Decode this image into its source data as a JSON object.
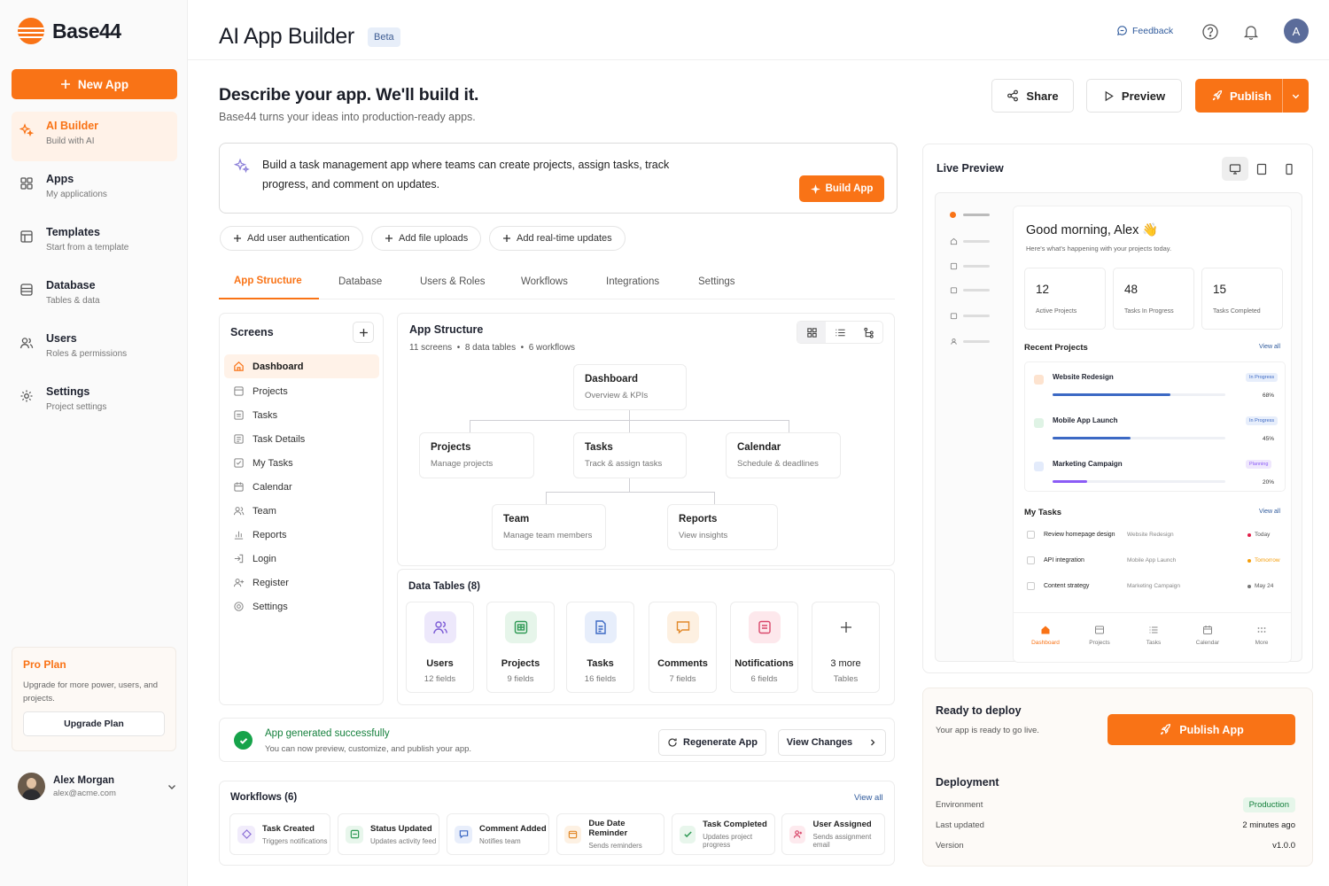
{
  "sidebar": {
    "brand": "Base44",
    "new_app": "New App",
    "items": [
      {
        "title": "AI Builder",
        "sub": "Build with AI",
        "icon": "sparkles-icon"
      },
      {
        "title": "Apps",
        "sub": "My applications",
        "icon": "grid-icon"
      },
      {
        "title": "Templates",
        "sub": "Start from a template",
        "icon": "template-icon"
      },
      {
        "title": "Database",
        "sub": "Tables & data",
        "icon": "database-icon"
      },
      {
        "title": "Users",
        "sub": "Roles & permissions",
        "icon": "users-icon"
      },
      {
        "title": "Settings",
        "sub": "Project settings",
        "icon": "gear-icon"
      }
    ],
    "pro": {
      "title": "Pro Plan",
      "desc": "Upgrade for more power, users, and projects.",
      "button": "Upgrade Plan"
    },
    "user": {
      "name": "Alex Morgan",
      "email": "alex@acme.com"
    }
  },
  "header": {
    "title": "AI App Builder",
    "badge": "Beta",
    "feedback": "Feedback",
    "avatar_letter": "A"
  },
  "main": {
    "headline": "Describe your app. We'll build it.",
    "subline": "Base44 turns your ideas into production-ready apps.",
    "share": "Share",
    "preview": "Preview",
    "publish": "Publish",
    "prompt": "Build a task management app where teams can create projects, assign tasks, track progress, and comment on updates.",
    "build_app": "Build App",
    "suggestions": [
      "Add user authentication",
      "Add file uploads",
      "Add real-time updates"
    ],
    "tabs": [
      "App Structure",
      "Database",
      "Users & Roles",
      "Workflows",
      "Integrations",
      "Settings"
    ],
    "screens": {
      "title": "Screens",
      "items": [
        "Dashboard",
        "Projects",
        "Tasks",
        "Task Details",
        "My Tasks",
        "Calendar",
        "Team",
        "Reports",
        "Login",
        "Register",
        "Settings"
      ]
    },
    "structure": {
      "title": "App Structure",
      "meta": [
        "11 screens",
        "8 data tables",
        "6 workflows"
      ],
      "nodes": {
        "root": {
          "title": "Dashboard",
          "sub": "Overview & KPIs"
        },
        "projects": {
          "title": "Projects",
          "sub": "Manage projects"
        },
        "tasks": {
          "title": "Tasks",
          "sub": "Track & assign tasks"
        },
        "calendar": {
          "title": "Calendar",
          "sub": "Schedule & deadlines"
        },
        "team": {
          "title": "Team",
          "sub": "Manage team members"
        },
        "reports": {
          "title": "Reports",
          "sub": "View insights"
        }
      }
    },
    "data_tables": {
      "title": "Data Tables (8)",
      "items": [
        {
          "name": "Users",
          "sub": "12 fields",
          "color": "#ede8fb",
          "fg": "#7c5cd6"
        },
        {
          "name": "Projects",
          "sub": "9 fields",
          "color": "#e6f5ea",
          "fg": "#2f9a55"
        },
        {
          "name": "Tasks",
          "sub": "16 fields",
          "color": "#e7eefb",
          "fg": "#3c69c4"
        },
        {
          "name": "Comments",
          "sub": "7 fields",
          "color": "#fdf0e1",
          "fg": "#e2892a"
        },
        {
          "name": "Notifications",
          "sub": "6 fields",
          "color": "#fde8ec",
          "fg": "#d9476a"
        },
        {
          "name": "3 more",
          "sub": "Tables",
          "color": "#ffffff",
          "fg": "#444444"
        }
      ]
    },
    "success": {
      "title": "App generated successfully",
      "sub": "You can now preview, customize, and publish your app.",
      "regenerate": "Regenerate App",
      "view_changes": "View Changes"
    },
    "workflows": {
      "title": "Workflows (6)",
      "view_all": "View all",
      "items": [
        {
          "title": "Task Created",
          "sub": "Triggers notifications",
          "color": "#f1ecfb",
          "fg": "#8b6fd6"
        },
        {
          "title": "Status Updated",
          "sub": "Updates activity feed",
          "color": "#e8f6ec",
          "fg": "#2f9a55"
        },
        {
          "title": "Comment Added",
          "sub": "Notifies team",
          "color": "#e8eefb",
          "fg": "#3c69c4"
        },
        {
          "title": "Due Date Reminder",
          "sub": "Sends reminders",
          "color": "#fdf1e3",
          "fg": "#e2892a"
        },
        {
          "title": "Task Completed",
          "sub": "Updates project progress",
          "color": "#e8f6ec",
          "fg": "#2f9a55"
        },
        {
          "title": "User Assigned",
          "sub": "Sends assignment email",
          "color": "#fdeaee",
          "fg": "#d9476a"
        }
      ]
    }
  },
  "preview": {
    "title": "Live Preview",
    "greeting": "Good morning, Alex 👋",
    "greeting_sub": "Here's what's happening with your projects today.",
    "stats": [
      {
        "value": "12",
        "label": "Active Projects"
      },
      {
        "value": "48",
        "label": "Tasks In Progress"
      },
      {
        "value": "15",
        "label": "Tasks Completed"
      }
    ],
    "recent_title": "Recent Projects",
    "view_all": "View all",
    "projects": [
      {
        "name": "Website Redesign",
        "badge": "In Progress",
        "pct": "68%",
        "progress": 0.68,
        "color": "#3c69c4",
        "badge_bg": "#e7eefb",
        "badge_fg": "#3c69c4",
        "ico": "#fde3cf"
      },
      {
        "name": "Mobile App Launch",
        "badge": "In Progress",
        "pct": "45%",
        "progress": 0.45,
        "color": "#3c69c4",
        "badge_bg": "#e7eefb",
        "badge_fg": "#3c69c4",
        "ico": "#dff3e5"
      },
      {
        "name": "Marketing Campaign",
        "badge": "Planning",
        "pct": "20%",
        "progress": 0.2,
        "color": "#8b5cf6",
        "badge_bg": "#efe7fd",
        "badge_fg": "#8b5cf6",
        "ico": "#e3ebfb"
      }
    ],
    "tasks_title": "My Tasks",
    "tasks": [
      {
        "title": "Review homepage design",
        "project": "Website Redesign",
        "due": "Today",
        "dot": "#e11d48",
        "due_color": "#555555"
      },
      {
        "title": "API integration",
        "project": "Mobile App Launch",
        "due": "Tomorrow",
        "dot": "#f59e0b",
        "due_color": "#f59e0b"
      },
      {
        "title": "Content strategy",
        "project": "Marketing Campaign",
        "due": "May 24",
        "dot": "#777777",
        "due_color": "#555555"
      }
    ],
    "bottom_tabs": [
      "Dashboard",
      "Projects",
      "Tasks",
      "Calendar",
      "More"
    ]
  },
  "deploy": {
    "title": "Ready to deploy",
    "sub": "Your app is ready to go live.",
    "button": "Publish App",
    "section": "Deployment",
    "rows": [
      {
        "label": "Environment",
        "value": "Production"
      },
      {
        "label": "Last updated",
        "value": "2 minutes ago"
      },
      {
        "label": "Version",
        "value": "v1.0.0"
      }
    ]
  },
  "colors": {
    "accent": "#f97316",
    "link": "#2f5a9c",
    "success": "#16a34a"
  }
}
